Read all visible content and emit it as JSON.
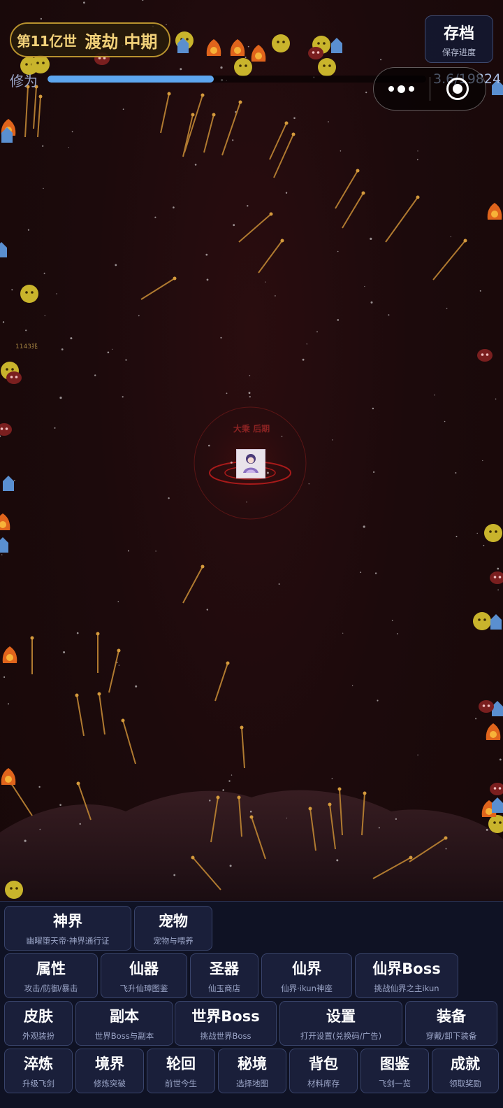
{
  "header": {
    "generation": "第11亿世",
    "stage": "渡劫",
    "phase": "中期",
    "save": {
      "title": "存档",
      "subtitle": "保存进度"
    }
  },
  "cultivation": {
    "label": "修为",
    "value_text": "3.6/19824",
    "bar_fill_fraction": 0.44
  },
  "capsule": {
    "more_icon": "more-dots-icon",
    "close_icon": "target-ring-icon"
  },
  "battlefield": {
    "player_title": "大乘 后期",
    "damage_text": "1143兆"
  },
  "menu": {
    "rows": [
      [
        {
          "title": "神界",
          "sub": "幽曜堕天帝·神界通行证"
        },
        {
          "title": "宠物",
          "sub": "宠物与喂养"
        }
      ],
      [
        {
          "title": "属性",
          "sub": "攻击/防御/暴击"
        },
        {
          "title": "仙器",
          "sub": "飞升仙璋图鉴"
        },
        {
          "title": "圣器",
          "sub": "仙玉商店"
        },
        {
          "title": "仙界",
          "sub": "仙界·ikun神座"
        },
        {
          "title": "仙界Boss",
          "sub": "挑战仙界之主ikun"
        }
      ],
      [
        {
          "title": "皮肤",
          "sub": "外观装扮"
        },
        {
          "title": "副本",
          "sub": "世界Boss与副本"
        },
        {
          "title": "世界Boss",
          "sub": "挑战世界Boss"
        },
        {
          "title": "设置",
          "sub": "打开设置(兑换码/广告)"
        },
        {
          "title": "装备",
          "sub": "穿戴/卸下装备"
        }
      ],
      [
        {
          "title": "淬炼",
          "sub": "升级飞剑"
        },
        {
          "title": "境界",
          "sub": "修炼突破"
        },
        {
          "title": "轮回",
          "sub": "前世今生"
        },
        {
          "title": "秘境",
          "sub": "选择地图"
        },
        {
          "title": "背包",
          "sub": "材料库存"
        },
        {
          "title": "图鉴",
          "sub": "飞剑一览"
        },
        {
          "title": "成就",
          "sub": "领取奖励"
        }
      ]
    ]
  },
  "colors": {
    "accent_gold": "#f3d27a",
    "progress_blue": "#5da6ef",
    "menu_bg": "#1a1f3a"
  }
}
